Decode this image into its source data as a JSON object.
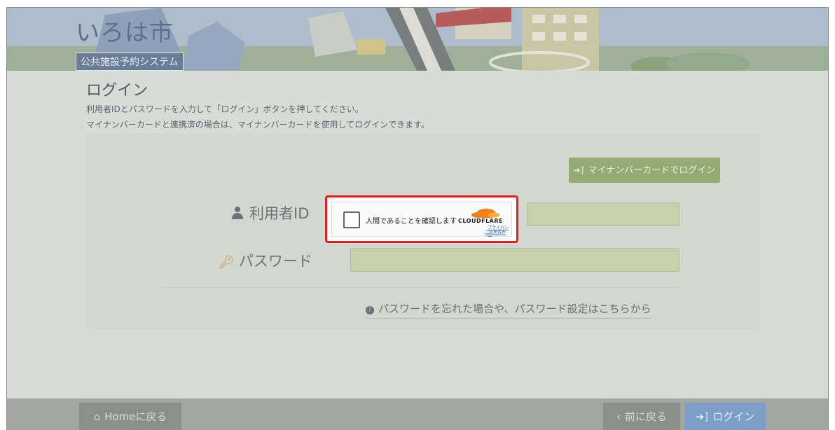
{
  "header": {
    "city_name": "いろは市",
    "system_name": "公共施設予約システム"
  },
  "page": {
    "title": "ログイン",
    "description_line1": "利用者IDとパスワードを入力して「ログイン」ボタンを押してください。",
    "description_line2": "マイナンバーカードと連携済の場合は、マイナンバーカードを使用してログインできます。"
  },
  "form": {
    "mynumber_login_label": "マイナンバーカードでログイン",
    "userid_label": "利用者ID",
    "userid_value": "",
    "password_label": "パスワード",
    "password_value": "",
    "forgot_password_link": "パスワードを忘れた場合や、パスワード設定はこちらから"
  },
  "turnstile": {
    "checkbox_label": "人間であることを確認します",
    "provider": "CLOUDFLARE",
    "privacy_link": "プライバシー",
    "terms_link": "ご利用条件"
  },
  "footer": {
    "home_label": "Homeに戻る",
    "back_label": "前に戻る",
    "login_label": "ログイン"
  },
  "icons": {
    "user": "user-icon",
    "key": "key-icon",
    "login": "sign-in-icon",
    "home": "home-icon",
    "back": "chevron-left-icon",
    "help": "question-circle-icon"
  },
  "colors": {
    "accent_green": "#94ab73",
    "login_blue": "#7d9fc7",
    "highlight_red": "#d6251d"
  }
}
